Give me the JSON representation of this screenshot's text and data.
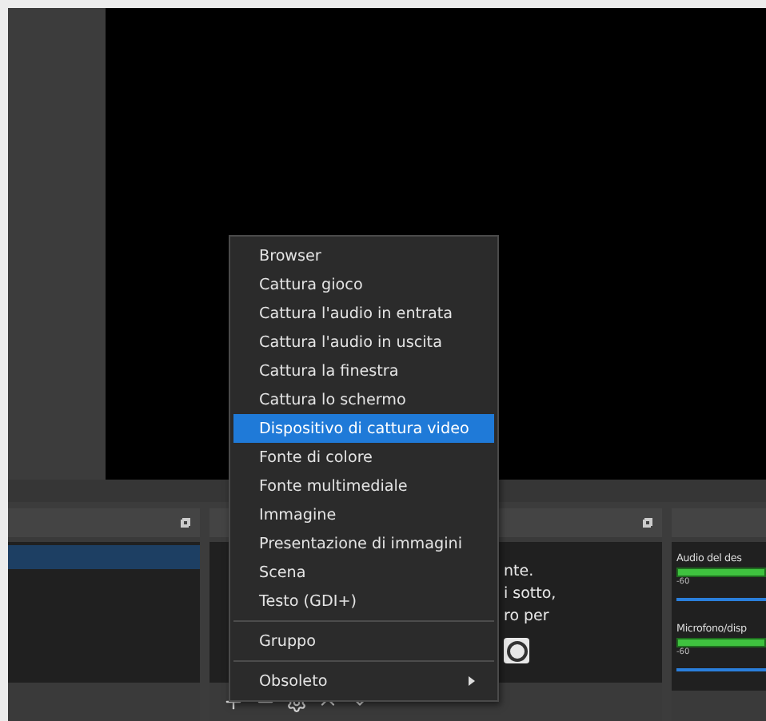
{
  "sources_panel": {
    "hint_lines": [
      "nte.",
      "i sotto,",
      "ro per"
    ]
  },
  "audio_mixer": {
    "channels": [
      {
        "name": "Audio del des",
        "scale": "-60"
      },
      {
        "name": "Microfono/disp",
        "scale": "-60"
      }
    ]
  },
  "context_menu": {
    "items": [
      {
        "kind": "item",
        "label": "Browser",
        "selected": false
      },
      {
        "kind": "item",
        "label": "Cattura gioco",
        "selected": false
      },
      {
        "kind": "item",
        "label": "Cattura l'audio in entrata",
        "selected": false
      },
      {
        "kind": "item",
        "label": "Cattura l'audio in uscita",
        "selected": false
      },
      {
        "kind": "item",
        "label": "Cattura la finestra",
        "selected": false
      },
      {
        "kind": "item",
        "label": "Cattura lo schermo",
        "selected": false
      },
      {
        "kind": "item",
        "label": "Dispositivo di cattura video",
        "selected": true
      },
      {
        "kind": "item",
        "label": "Fonte di colore",
        "selected": false
      },
      {
        "kind": "item",
        "label": "Fonte multimediale",
        "selected": false
      },
      {
        "kind": "item",
        "label": "Immagine",
        "selected": false
      },
      {
        "kind": "item",
        "label": "Presentazione di immagini",
        "selected": false
      },
      {
        "kind": "item",
        "label": "Scena",
        "selected": false
      },
      {
        "kind": "item",
        "label": "Testo (GDI+)",
        "selected": false
      },
      {
        "kind": "separator"
      },
      {
        "kind": "item",
        "label": "Gruppo",
        "selected": false
      },
      {
        "kind": "separator"
      },
      {
        "kind": "submenu",
        "label": "Obsoleto",
        "selected": false
      }
    ]
  }
}
